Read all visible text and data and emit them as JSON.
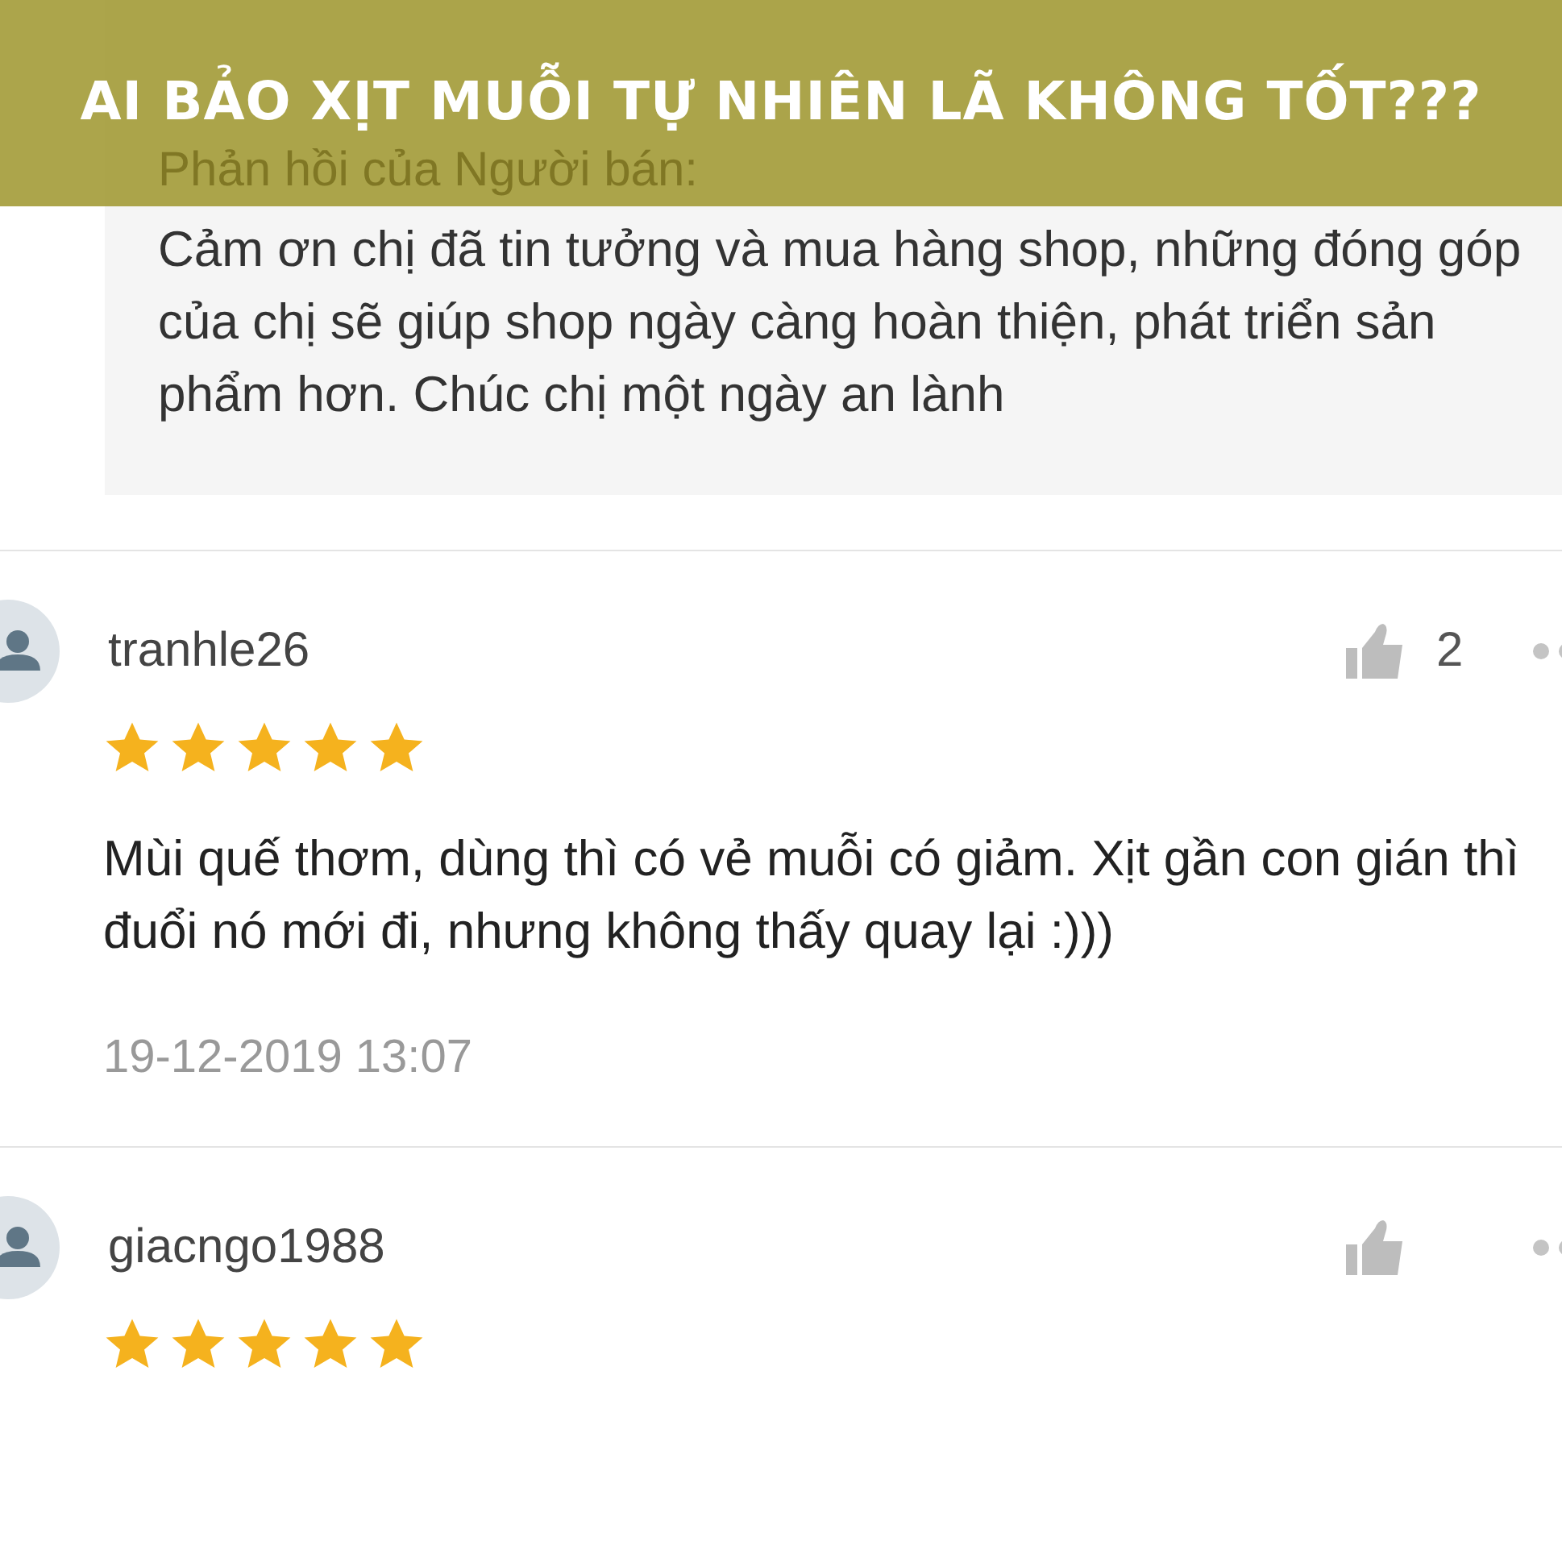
{
  "banner": {
    "title": "AI BẢO XỊT MUỖI TỰ NHIÊN LÃ KHÔNG TỐT???"
  },
  "seller_reply": {
    "label": "Phản hồi của Người bán:",
    "text": "Cảm ơn chị đã tin tưởng và mua hàng shop, những đóng góp của chị sẽ giúp shop ngày càng hoàn thiện, phát triển sản phẩm hơn. Chúc chị một ngày an lành"
  },
  "reviews": [
    {
      "username": "tranhle26",
      "likes": "2",
      "stars": 5,
      "comment": "Mùi quế thơm, dùng thì có vẻ muỗi có giảm. Xịt gần con gián thì đuổi nó mới đi, nhưng không thấy quay lại :)))",
      "date": "19-12-2019 13:07"
    },
    {
      "username": "giacngo1988",
      "stars": 5
    }
  ]
}
